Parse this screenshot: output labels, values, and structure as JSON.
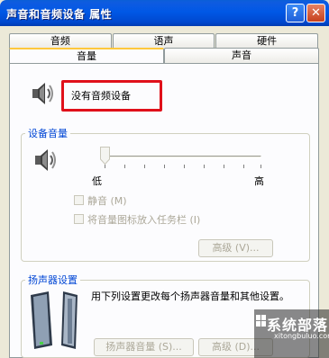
{
  "window": {
    "title": "声音和音频设备 属性"
  },
  "tabs": {
    "top": [
      {
        "label": "音频"
      },
      {
        "label": "语声"
      },
      {
        "label": "硬件"
      }
    ],
    "bottom": [
      {
        "label": "音量",
        "active": true
      },
      {
        "label": "声音",
        "active": false
      }
    ]
  },
  "volume": {
    "device_name": "没有音频设备",
    "device_volume_group": "设备音量",
    "slider": {
      "min_label": "低",
      "max_label": "高",
      "level": 0.0
    },
    "mute_label": "静音 (M)",
    "taskbar_label": "将音量图标放入任务栏 (I)",
    "advanced_label": "高级 (V)..."
  },
  "speaker_settings": {
    "group_label": "扬声器设置",
    "description": "用下列设置更改每个扬声器音量和其他设置。",
    "speaker_volume_label": "扬声器音量 (S)...",
    "advanced_label": "高级 (D)..."
  },
  "watermark": {
    "text": "系统部落",
    "sub": "xitongbuluo.com"
  },
  "colors": {
    "titlebar": "#0058E6",
    "accent_tab": "#FFC83C",
    "highlight": "#E0101A",
    "group_label": "#0046D5"
  }
}
